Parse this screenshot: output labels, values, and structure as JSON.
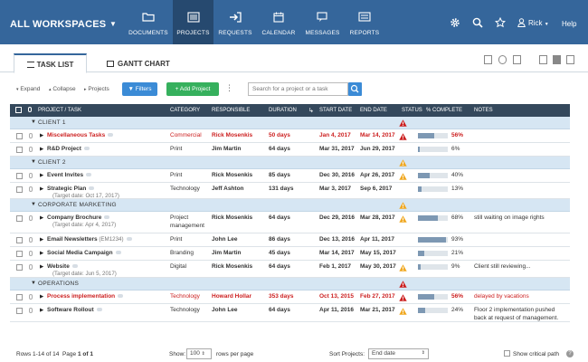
{
  "nav": {
    "workspace": "ALL WORKSPACES",
    "items": [
      {
        "label": "DOCUMENTS"
      },
      {
        "label": "PROJECTS"
      },
      {
        "label": "REQUESTS"
      },
      {
        "label": "CALENDAR"
      },
      {
        "label": "MESSAGES"
      },
      {
        "label": "REPORTS"
      }
    ],
    "active_item": "PROJECTS",
    "user": "Rick",
    "help": "Help"
  },
  "tabs": {
    "task_list": "TASK LIST",
    "gantt_chart": "GANTT CHART"
  },
  "toolbar": {
    "expand": "Expand",
    "collapse": "Collapse",
    "projects": "Projects",
    "filters": "Filters",
    "add_project": "+ Add Project",
    "search_placeholder": "Search for a project or a task"
  },
  "columns": {
    "project": "PROJECT / TASK",
    "category": "CATEGORY",
    "responsible": "RESPONSIBLE",
    "duration": "DURATION",
    "start": "START DATE",
    "end": "END DATE",
    "status": "STATUS",
    "complete": "% COMPLETE",
    "notes": "NOTES"
  },
  "groups": [
    {
      "name": "CLIENT 1",
      "tasks": [
        {
          "name": "Miscellaneous Tasks",
          "category": "Commercial",
          "responsible": "Rick Mosenkis",
          "duration": "50 days",
          "start": "Jan 4, 2017",
          "end": "Mar 14, 2017",
          "complete": "56%",
          "progress": 0.56,
          "notes": ""
        },
        {
          "name": "R&D Project",
          "category": "Print",
          "responsible": "Jim Martin",
          "duration": "64 days",
          "start": "Mar 31, 2017",
          "end": "Jun 29, 2017",
          "complete": "6%",
          "progress": 0.06,
          "notes": ""
        }
      ]
    },
    {
      "name": "CLIENT 2",
      "tasks": [
        {
          "name": "Event Invites",
          "category": "Print",
          "responsible": "Rick Mosenkis",
          "duration": "85 days",
          "start": "Dec 30, 2016",
          "end": "Apr 26, 2017",
          "complete": "40%",
          "progress": 0.4,
          "notes": ""
        },
        {
          "name": "Strategic Plan",
          "sub": "(Target date: Oct 17, 2017)",
          "category": "Technology",
          "responsible": "Jeff Ashton",
          "duration": "131 days",
          "start": "Mar 3, 2017",
          "end": "Sep 6, 2017",
          "complete": "13%",
          "progress": 0.13,
          "notes": ""
        }
      ]
    },
    {
      "name": "CORPORATE MARKETING",
      "tasks": [
        {
          "name": "Company Brochure",
          "sub": "(Target date: Apr 4, 2017)",
          "category": "Project",
          "category2": "management",
          "responsible": "Rick Mosenkis",
          "duration": "64 days",
          "start": "Dec 29, 2016",
          "end": "Mar 28, 2017",
          "complete": "68%",
          "progress": 0.68,
          "notes": "still waiting on image rights"
        },
        {
          "name": "Email Newsletters",
          "code": "(EM1234)",
          "category": "Print",
          "responsible": "John Lee",
          "duration": "86 days",
          "start": "Dec 13, 2016",
          "end": "Apr 11, 2017",
          "complete": "93%",
          "progress": 0.93,
          "notes": ""
        },
        {
          "name": "Social Media Campaign",
          "category": "Branding",
          "responsible": "Jim Martin",
          "duration": "45 days",
          "start": "Mar 14, 2017",
          "end": "May 15, 2017",
          "complete": "21%",
          "progress": 0.21,
          "notes": ""
        },
        {
          "name": "Website",
          "sub": "(Target date: Jun 5, 2017)",
          "category": "Digital",
          "responsible": "Rick Mosenkis",
          "duration": "64 days",
          "start": "Feb 1, 2017",
          "end": "May 30, 2017",
          "complete": "9%",
          "progress": 0.09,
          "notes": "Client still reviewing..."
        }
      ]
    },
    {
      "name": "OPERATIONS",
      "tasks": [
        {
          "name": "Process implementation",
          "category": "Technology",
          "responsible": "Howard Hollar",
          "duration": "353 days",
          "start": "Oct 13, 2015",
          "end": "Feb 27, 2017",
          "complete": "56%",
          "progress": 0.56,
          "notes": "delayed by vacations"
        },
        {
          "name": "Software Rollout",
          "category": "Technology",
          "responsible": "John Lee",
          "duration": "64 days",
          "start": "Apr 11, 2016",
          "end": "Mar 21, 2017",
          "complete": "24%",
          "progress": 0.24,
          "notes": "Floor 2 implementation pushed",
          "notes2": "back at request of management."
        }
      ]
    }
  ],
  "footer": {
    "rows": "Rows 1-14 of 14",
    "page": "Page",
    "page_num": "1 of 1",
    "show": "Show:",
    "show_value": "100",
    "rows_per_page": "rows per page",
    "sort_label": "Sort Projects:",
    "sort_value": "End date",
    "critical_path": "Show critical path"
  },
  "colors": {
    "nav": "#35669b",
    "nav_active": "#26496f",
    "header": "#34485c",
    "group": "#d6e6f3",
    "overdue": "#cc1f1f",
    "warning": "#f0a821",
    "filters": "#3b8bd6",
    "add": "#36b05d"
  }
}
